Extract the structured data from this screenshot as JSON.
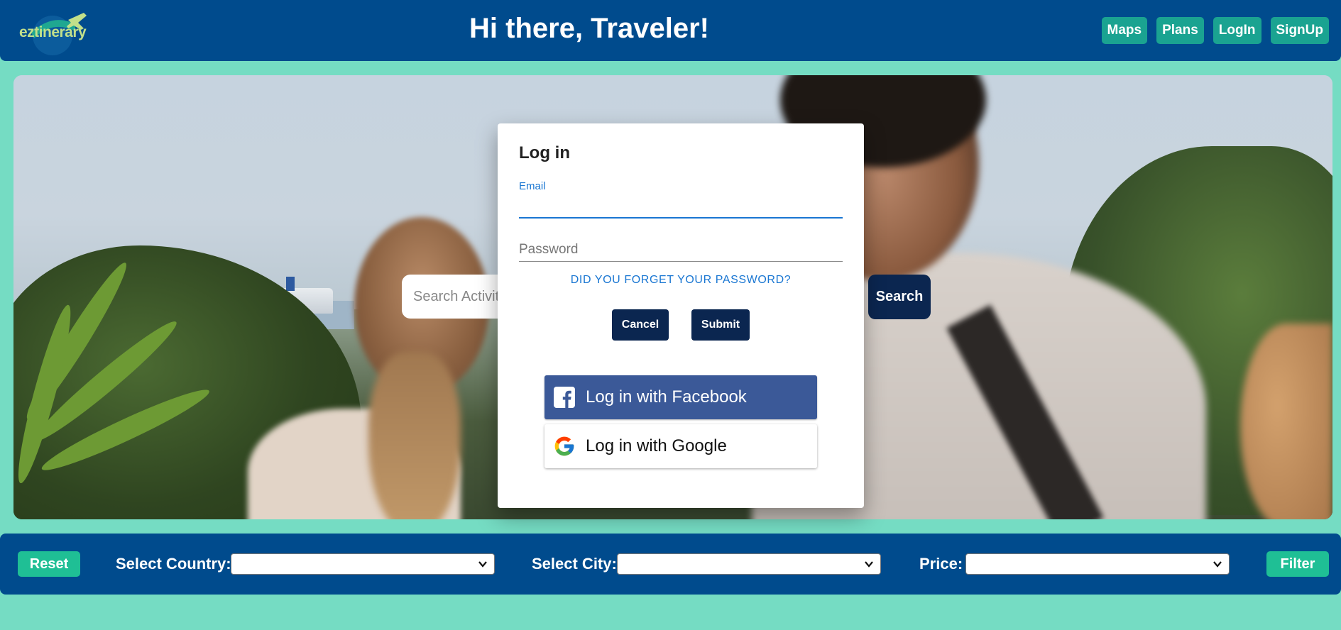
{
  "header": {
    "logo_text": "eztinerary",
    "title": "Hi there, Traveler!",
    "nav": [
      "Maps",
      "Plans",
      "LogIn",
      "SignUp"
    ]
  },
  "hero": {
    "search_placeholder": "Search Activit",
    "search_button": "Search"
  },
  "login": {
    "title": "Log in",
    "email_label": "Email",
    "email_value": "",
    "password_placeholder": "Password",
    "forgot_link": "DID YOU FORGET YOUR PASSWORD?",
    "cancel": "Cancel",
    "submit": "Submit",
    "facebook": "Log in with Facebook",
    "google": "Log in with Google"
  },
  "filters": {
    "reset": "Reset",
    "country_label": "Select Country:",
    "city_label": "Select City:",
    "price_label": "Price:",
    "country_value": "",
    "city_value": "",
    "price_value": "",
    "filter": "Filter"
  },
  "colors": {
    "background": "#75dcc3",
    "header": "#004b8d",
    "nav_button": "#1aa391",
    "dark_button": "#0b2650",
    "link": "#1976d2",
    "facebook": "#3b5998",
    "filter_button": "#1fbf95"
  },
  "icons": {
    "logo": "airplane-globe-logo",
    "facebook": "facebook-icon",
    "google": "google-icon",
    "select": "chevron-down-icon"
  }
}
